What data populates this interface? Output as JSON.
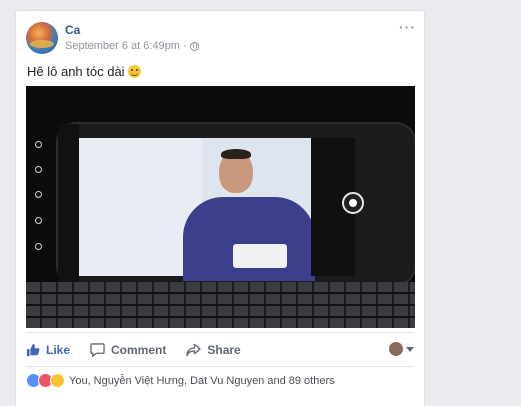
{
  "post": {
    "author": "Ca",
    "timestamp": "September 6 at 6:49pm",
    "separator": "·",
    "more_label": "···",
    "text": "Hê lô anh tóc dài"
  },
  "actions": {
    "like": "Like",
    "comment": "Comment",
    "share": "Share"
  },
  "reactions": {
    "summary": "You, Nguyễn Việt Hưng, Dat Vu Nguyen and 89 others",
    "types": [
      "like",
      "love",
      "haha"
    ]
  },
  "colors": {
    "brand": "#4267b2",
    "author": "#365899",
    "meta": "#90949c",
    "background": "#e9ebee"
  }
}
